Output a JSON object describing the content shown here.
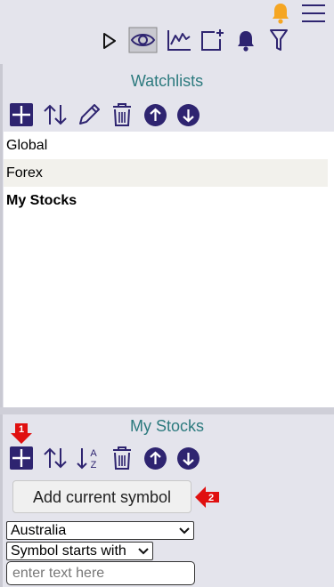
{
  "watchlists_panel": {
    "title": "Watchlists",
    "items": [
      {
        "label": "Global"
      },
      {
        "label": "Forex"
      },
      {
        "label": "My Stocks"
      }
    ]
  },
  "symbols_panel": {
    "title": "My Stocks",
    "add_current_symbol_label": "Add current symbol",
    "country_select_value": "Australia",
    "match_mode_select_value": "Symbol starts with",
    "search_placeholder": "enter text here"
  },
  "callouts": {
    "add_marker": "1",
    "add_symbol_marker": "2"
  },
  "colors": {
    "icon_navy": "#2e2470",
    "title_teal": "#2c7a7e",
    "alert_bell": "#f5a623",
    "callout_red": "#e01010"
  },
  "icons": {
    "top_toolbar": [
      "play-icon",
      "eye-icon",
      "chart-icon",
      "new-window-icon",
      "bell-icon",
      "filter-icon"
    ],
    "list_toolbar": [
      "add-icon",
      "sort-icon",
      "edit-icon",
      "delete-icon",
      "move-up-icon",
      "move-down-icon"
    ],
    "symbols_toolbar": [
      "add-icon",
      "sort-icon",
      "sort-az-icon",
      "delete-icon",
      "move-up-icon",
      "move-down-icon"
    ]
  }
}
